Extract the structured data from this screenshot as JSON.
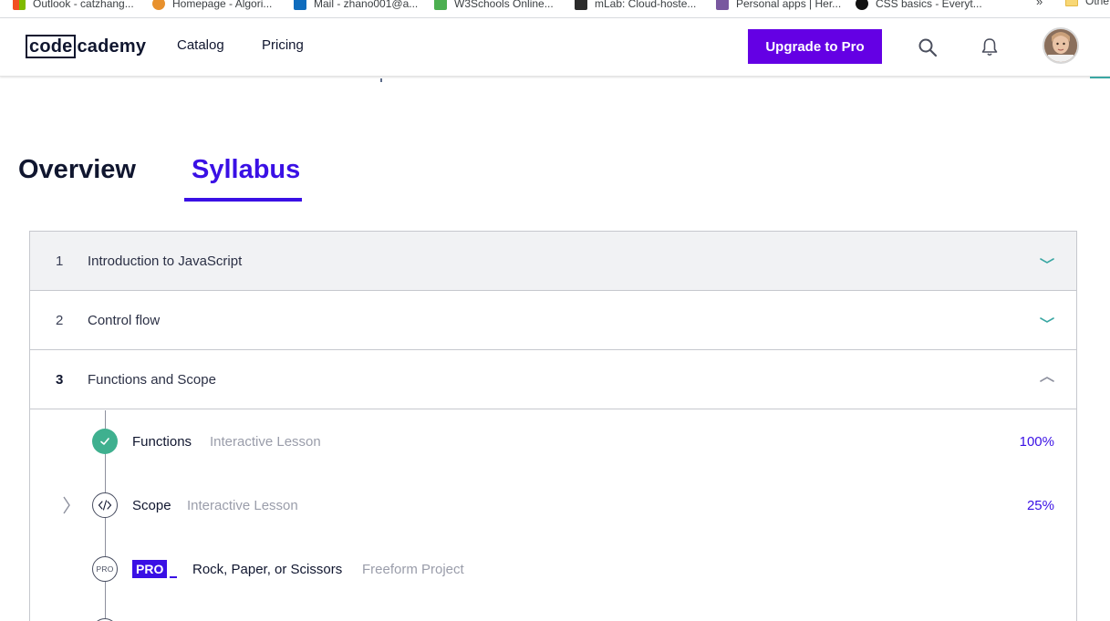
{
  "bookmarks": {
    "items": [
      {
        "label": "Outlook - catzhang...",
        "icon": "microsoft-tiles-icon",
        "color": "#f25022"
      },
      {
        "label": "Homepage - Algori...",
        "icon": "algorithm-logo-icon",
        "color": "#e8912d"
      },
      {
        "label": "Mail - zhano001@a...",
        "icon": "outlook-mail-icon",
        "color": "#0f6cbd"
      },
      {
        "label": "W3Schools Online...",
        "icon": "w3schools-icon",
        "color": "#4caf50"
      },
      {
        "label": "mLab: Cloud-hoste...",
        "icon": "mlab-icon",
        "color": "#2b2b2b"
      },
      {
        "label": "Personal apps | Her...",
        "icon": "heroku-icon",
        "color": "#79589f"
      },
      {
        "label": "CSS basics - Everyt...",
        "icon": "github-icon",
        "color": "#111111"
      }
    ],
    "more": "»",
    "other": "Othe"
  },
  "header": {
    "logo_boxed": "code",
    "logo_rest": "cademy",
    "nav": [
      "Catalog",
      "Pricing"
    ],
    "upgrade_label": "Upgrade to Pro",
    "accent": "#6400e4"
  },
  "tabs": {
    "overview": "Overview",
    "syllabus": "Syllabus",
    "active": "Syllabus"
  },
  "modules": [
    {
      "number": "1",
      "title": "Introduction to JavaScript",
      "expanded": false,
      "icon": "chevron-down-icon"
    },
    {
      "number": "2",
      "title": "Control flow",
      "expanded": false,
      "icon": "chevron-down-icon"
    },
    {
      "number": "3",
      "title": "Functions and Scope",
      "expanded": true,
      "icon": "chevron-up-icon"
    }
  ],
  "lessons": [
    {
      "name": "Functions",
      "type": "Interactive Lesson",
      "progress": "100%",
      "icon": "check-icon",
      "status": "complete"
    },
    {
      "name": "Scope",
      "type": "Interactive Lesson",
      "progress": "25%",
      "icon": "code-icon",
      "status": "in-progress"
    },
    {
      "name": "Rock, Paper, or Scissors",
      "type": "Freeform Project",
      "progress": "",
      "icon": "pro-icon",
      "badge": "PRO",
      "circle_label": "PRO",
      "status": "locked"
    }
  ],
  "colors": {
    "brand_purple": "#3a10e5",
    "upgrade_purple": "#6400e4",
    "complete_green": "#3fb08f",
    "chevron_teal": "#3aa7a3"
  }
}
